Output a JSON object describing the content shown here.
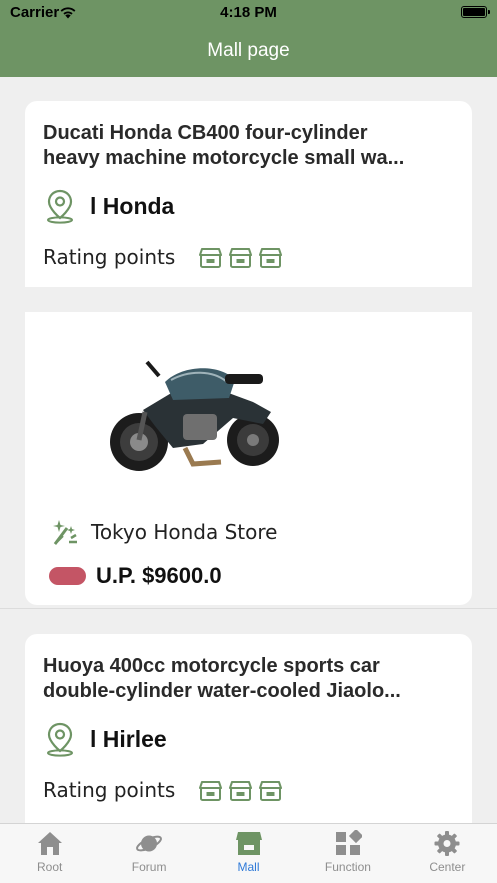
{
  "status_bar": {
    "carrier": "Carrier",
    "time": "4:18 PM"
  },
  "nav": {
    "title": "Mall page"
  },
  "products": [
    {
      "title_line1": "Ducati Honda CB400 four-cylinder",
      "title_line2": "heavy machine motorcycle small wa...",
      "brand": "l Honda",
      "rating_label": "Rating points",
      "rating": 3
    },
    {
      "title_line1": "Huoya 400cc motorcycle sports car",
      "title_line2": "double-cylinder water-cooled Jiaolo...",
      "brand": "l Hirlee",
      "rating_label": "Rating points",
      "rating": 3
    }
  ],
  "featured": {
    "store_name": "Tokyo Honda Store",
    "price": "U.P. $9600.0",
    "price_pill_color": "#c45565"
  },
  "colors": {
    "accent": "#6e9464",
    "tab_active": "#2f7ad8",
    "tab_inactive": "#8e8e8e"
  },
  "tabs": [
    {
      "label": "Root",
      "icon": "home-icon"
    },
    {
      "label": "Forum",
      "icon": "planet-icon"
    },
    {
      "label": "Mall",
      "icon": "store-icon",
      "active": true
    },
    {
      "label": "Function",
      "icon": "grid-icon"
    },
    {
      "label": "Center",
      "icon": "gear-icon"
    }
  ]
}
